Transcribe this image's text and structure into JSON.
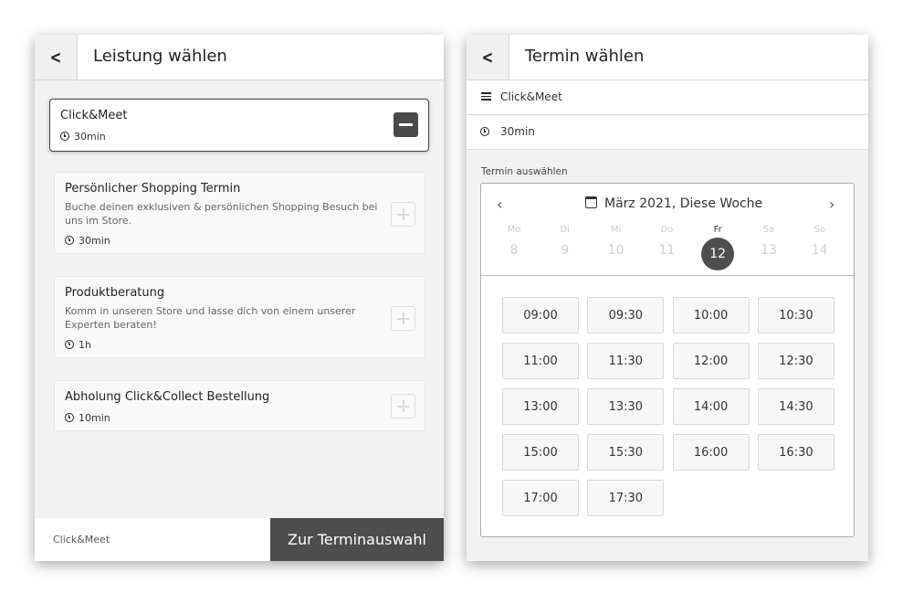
{
  "left": {
    "header": {
      "title": "Leistung wählen",
      "back_icon": "chevron-left-icon"
    },
    "selected": {
      "title": "Click&Meet",
      "duration": "30min"
    },
    "services": [
      {
        "title": "Persönlicher Shopping Termin",
        "description": "Buche deinen exklusiven & persönlichen Shopping Besuch bei uns im Store.",
        "duration": "30min"
      },
      {
        "title": "Produktberatung",
        "description": "Komm in unseren Store und lasse dich von einem unserer Experten beraten!",
        "duration": "1h"
      },
      {
        "title": "Abholung Click&Collect Bestellung",
        "description": "",
        "duration": "10min"
      }
    ],
    "footer": {
      "summary": "Click&Meet",
      "button": "Zur Terminauswahl"
    }
  },
  "right": {
    "header": {
      "title": "Termin wählen",
      "back_icon": "chevron-left-icon"
    },
    "service": "Click&Meet",
    "duration": "30min",
    "section_label": "Termin auswählen",
    "calendar": {
      "title": "März 2021, Diese Woche",
      "prev": "‹",
      "next": "›",
      "days": [
        {
          "name": "Mo",
          "num": "8"
        },
        {
          "name": "Di",
          "num": "9"
        },
        {
          "name": "Mi",
          "num": "10"
        },
        {
          "name": "Do",
          "num": "11"
        },
        {
          "name": "Fr",
          "num": "12",
          "active": true
        },
        {
          "name": "Sa",
          "num": "13"
        },
        {
          "name": "So",
          "num": "14"
        }
      ],
      "slots": [
        "09:00",
        "09:30",
        "10:00",
        "10:30",
        "11:00",
        "11:30",
        "12:00",
        "12:30",
        "13:00",
        "13:30",
        "14:00",
        "14:30",
        "15:00",
        "15:30",
        "16:00",
        "16:30",
        "17:00",
        "17:30"
      ]
    }
  },
  "colors": {
    "accent": "#4d4d4d",
    "background": "#f2f2f2"
  }
}
